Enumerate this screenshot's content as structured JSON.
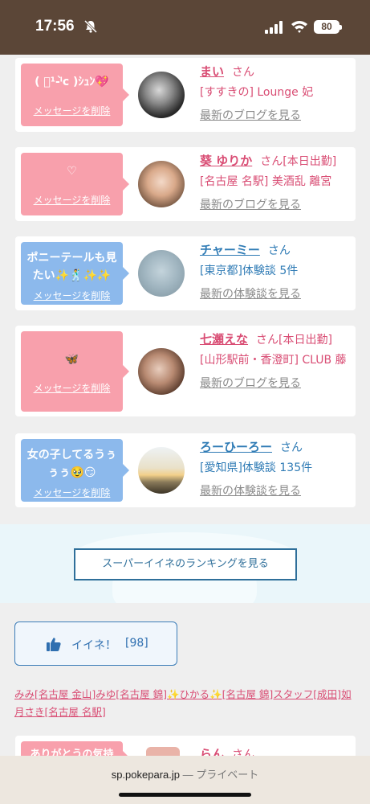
{
  "status_bar": {
    "time": "17:56",
    "battery": "80"
  },
  "entries": [
    {
      "message": "( ﾟ¹-ˡ̀ᴄ )ｼｭﾝ💖",
      "delete_label": "メッセージを削除",
      "name": "まい",
      "honorific": "さん",
      "tag": "",
      "shop": "[すすきの] Lounge 妃",
      "link": "最新のブログを見る",
      "bubble_color": "pink"
    },
    {
      "message": "♡",
      "delete_label": "メッセージを削除",
      "name": "葵 ゆりか",
      "honorific": "さん",
      "tag": "[本日出勤]",
      "shop": "[名古屋 名駅] 美酒乱 離宮",
      "link": "最新のブログを見る",
      "bubble_color": "pink"
    },
    {
      "message": "ポニーテールも見たい✨🕺✨✨",
      "delete_label": "メッセージを削除",
      "name": "チャーミー",
      "honorific": "さん",
      "tag": "",
      "shop": "[東京都]体験談 5件",
      "link": "最新の体験談を見る",
      "bubble_color": "blue"
    },
    {
      "message": "🦋",
      "delete_label": "メッセージを削除",
      "name": "七瀬えな",
      "honorific": "さん",
      "tag": "[本日出勤]",
      "shop": "[山形駅前・香澄町] CLUB 藤",
      "link": "最新のブログを見る",
      "bubble_color": "pink"
    },
    {
      "message": "女の子してるうぅぅぅ🥹😏",
      "delete_label": "メッセージを削除",
      "name": "ろーひーろー",
      "honorific": "さん",
      "tag": "",
      "shop": "[愛知県]体験談 135件",
      "link": "最新の体験談を見る",
      "bubble_color": "blue"
    }
  ],
  "partial_entry": {
    "message": "ありがとうの気持",
    "name": "らん",
    "honorific": "さん"
  },
  "ranking_button": "スーパーイイネのランキングを見る",
  "iine": {
    "label": "イイネ！",
    "count": "[98]"
  },
  "liked_by": "みみ[名古屋 金山]みゆ[名古屋 錦]✨ひかる✨[名古屋 錦]スタッフ[成田]如月さき[名古屋 名駅]",
  "browser": {
    "domain": "sp.pokepara.jp",
    "separator": "—",
    "mode": "プライベート"
  },
  "colors": {
    "status_bar": "#5b4637",
    "pink": "#f8a0ac",
    "blue": "#8cb9ec",
    "name_pink": "#d94d74",
    "name_blue": "#2f7bb5"
  }
}
